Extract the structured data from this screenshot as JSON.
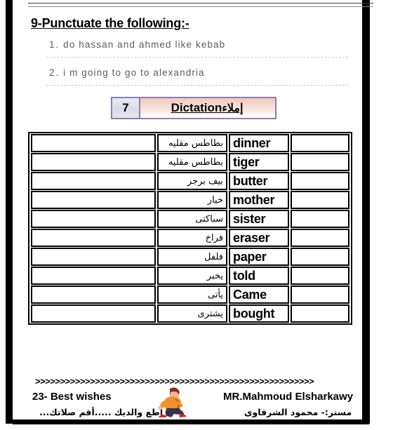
{
  "worksheet": {
    "heading": "9-Punctuate the following:-",
    "questions": [
      {
        "num": "1.",
        "text": "do hassan and ahmed like kebab"
      },
      {
        "num": "2.",
        "text": "i m going to go to alexandria"
      }
    ],
    "section": {
      "number": "7",
      "title_en": "Dictation",
      "title_ar": "إملاء"
    },
    "table": {
      "rows": [
        {
          "blank_left": "",
          "arabic": "بطاطس مقليه",
          "english": "dinner",
          "blank_right": ""
        },
        {
          "blank_left": "",
          "arabic": "بطاطس مقليه",
          "english": "tiger",
          "blank_right": ""
        },
        {
          "blank_left": "",
          "arabic": "بيف برجر",
          "english": "butter",
          "blank_right": ""
        },
        {
          "blank_left": "",
          "arabic": "خيار",
          "english": "mother",
          "blank_right": ""
        },
        {
          "blank_left": "",
          "arabic": "سباكتى",
          "english": "sister",
          "blank_right": ""
        },
        {
          "blank_left": "",
          "arabic": "فراخ",
          "english": "eraser",
          "blank_right": ""
        },
        {
          "blank_left": "",
          "arabic": "فلفل",
          "english": "paper",
          "blank_right": ""
        },
        {
          "blank_left": "",
          "arabic": "يخبر",
          "english": "told",
          "blank_right": ""
        },
        {
          "blank_left": "",
          "arabic": "يأتى",
          "english": "Came",
          "blank_right": ""
        },
        {
          "blank_left": "",
          "arabic": "يشترى",
          "english": "bought",
          "blank_right": ""
        }
      ]
    },
    "footer": {
      "arrows": ">>>>>>>>>>>>>>>>>>>>>>>>>>>>>>>>>>>>>>>>>>>>>>>>>>>>>>>>",
      "page_and_wish": "23-  Best wishes",
      "teacher_en": "MR.Mahmoud Elsharkawy",
      "teacher_ar": "مستر:- محمود الشرقاوى",
      "advice_ar": "أطع والديك .....أقم صلاتك...",
      "clipart": "running-boy-icon"
    }
  },
  "colors": {
    "frame": "#000000",
    "title_box_border": "#8a7fb0",
    "title_box_pink": "#f2c9c0",
    "question_text": "#5c5c5c"
  }
}
